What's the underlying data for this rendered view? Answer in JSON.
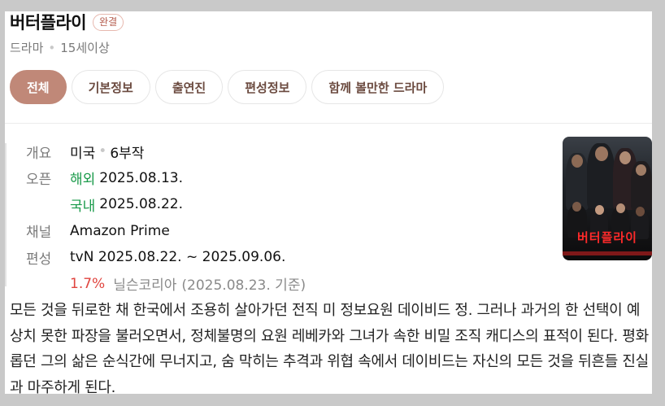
{
  "header": {
    "title": "버터플라이",
    "badge": "완결",
    "genre": "드라마",
    "rating": "15세이상"
  },
  "tabs": [
    {
      "label": "전체",
      "active": true
    },
    {
      "label": "기본정보",
      "active": false
    },
    {
      "label": "출연진",
      "active": false
    },
    {
      "label": "편성정보",
      "active": false
    },
    {
      "label": "함께 볼만한 드라마",
      "active": false
    }
  ],
  "info": {
    "overview_label": "개요",
    "country": "미국",
    "episodes": "6부작",
    "open_label": "오픈",
    "overseas_label": "해외",
    "overseas_date": "2025.08.13.",
    "domestic_label": "국내",
    "domestic_date": "2025.08.22.",
    "channel_label": "채널",
    "channel": "Amazon Prime",
    "schedule_label": "편성",
    "schedule": "tvN 2025.08.22. ~ 2025.09.06.",
    "rating_value": "1.7%",
    "rating_source": "닐슨코리아",
    "rating_date": "(2025.08.23. 기준)"
  },
  "poster": {
    "title_text": "버터플라이"
  },
  "synopsis": "모든 것을 뒤로한 채 한국에서 조용히 살아가던 전직 미 정보요원 데이비드 정. 그러나 과거의 한 선택이 예상치 못한 파장을 불러오면서, 정체불명의 요원 레베카와 그녀가 속한 비밀 조직 캐디스의 표적이 된다. 평화롭던 그의 삶은 순식간에 무너지고, 숨 막히는 추격과 위협 속에서 데이비드는 자신의 모든 것을 뒤흔들 진실과 마주하게 된다.",
  "colors": {
    "accent": "#c08878",
    "overseas_green": "#1a9a4a",
    "rating_red": "#e0453f"
  }
}
